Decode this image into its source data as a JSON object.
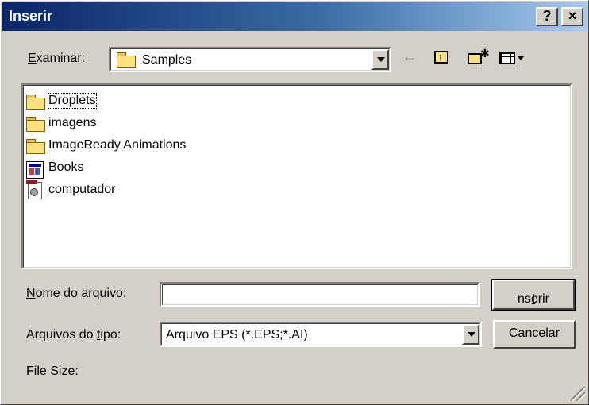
{
  "dialog": {
    "title": "Inserir",
    "help_label": "?",
    "close_label": "×"
  },
  "look_in": {
    "label_accel": "E",
    "label_rest": "xaminar:",
    "value": "Samples"
  },
  "toolbar": {
    "back": "back-icon",
    "up": "up-one-level-icon",
    "new_folder": "new-folder-icon",
    "view_menu": "view-menu-icon"
  },
  "files": [
    {
      "name": "Droplets",
      "type": "folder"
    },
    {
      "name": "imagens",
      "type": "folder"
    },
    {
      "name": "ImageReady Animations",
      "type": "folder"
    },
    {
      "name": "Books",
      "type": "document"
    },
    {
      "name": "computador",
      "type": "eps-file"
    }
  ],
  "filename": {
    "label_accel": "N",
    "label_rest": "ome do arquivo:",
    "value": ""
  },
  "filetype": {
    "label_pre": "Arquivos do ",
    "label_accel": "t",
    "label_rest": "ipo:",
    "value": "Arquivo EPS (*.EPS;*.AI)"
  },
  "buttons": {
    "insert_accel": "I",
    "insert_rest": "nserir",
    "cancel": "Cancelar"
  },
  "file_size_label": "File Size:"
}
